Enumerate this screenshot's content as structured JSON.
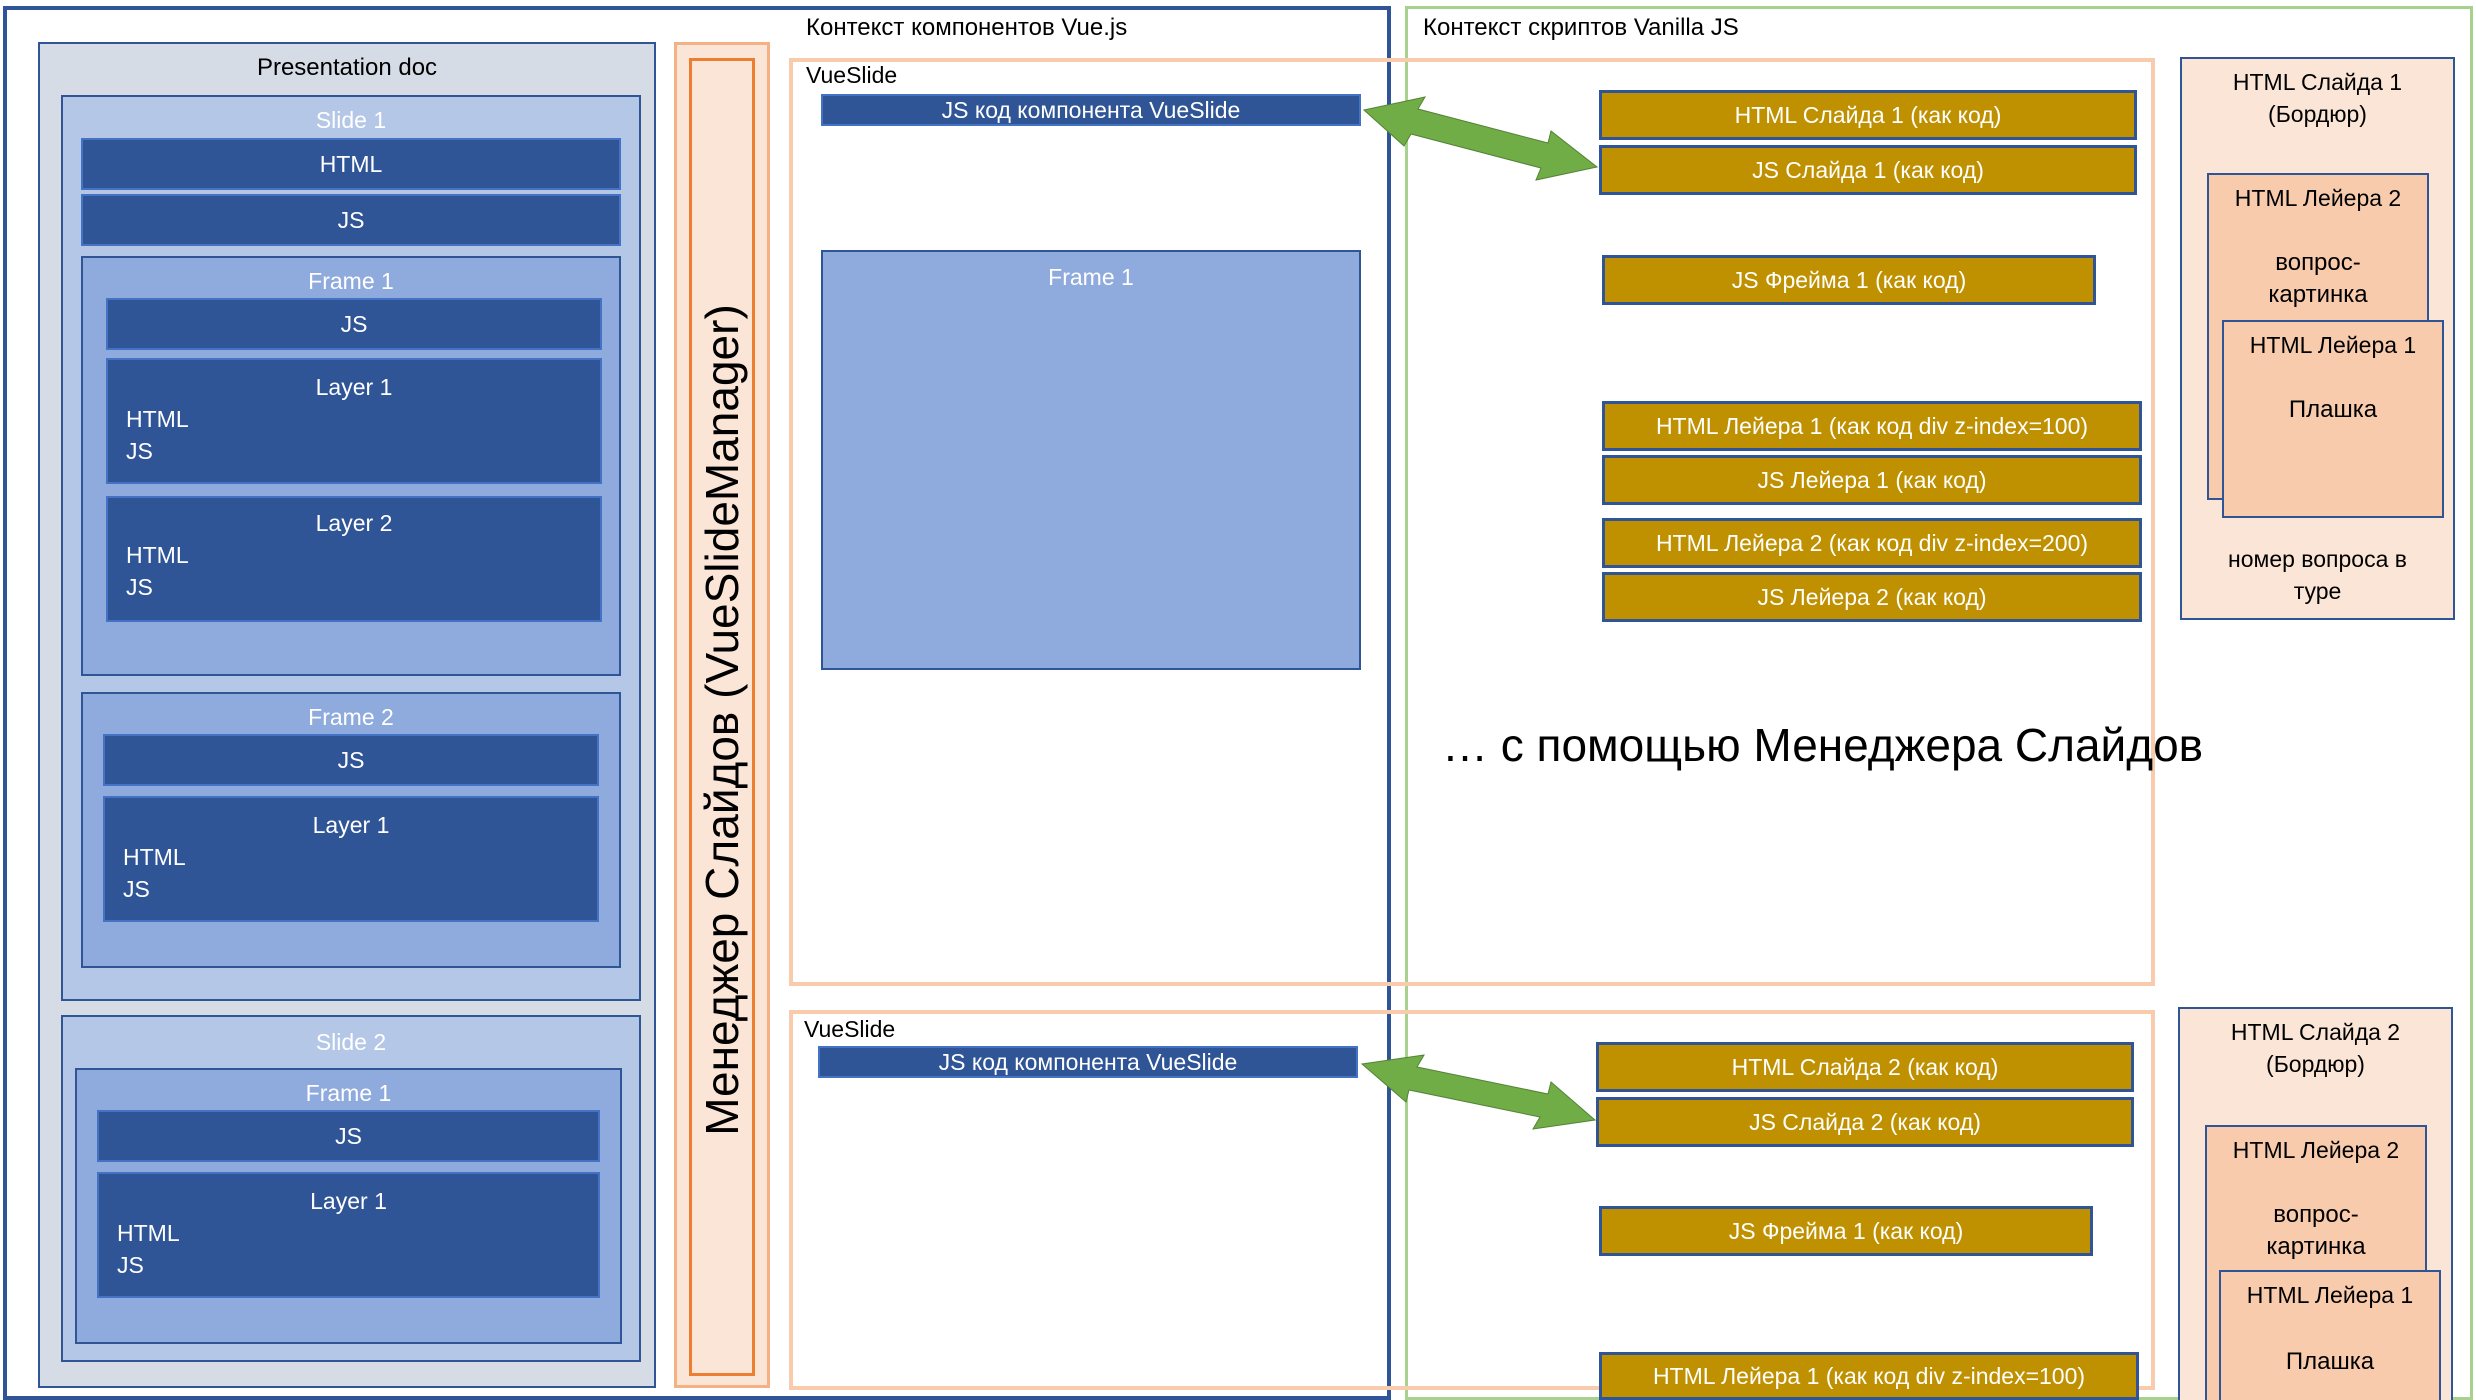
{
  "contexts": {
    "vue_label": "Контекст компонентов Vue.js",
    "vanilla_label": "Контекст скриптов Vanilla JS"
  },
  "presentation": {
    "title": "Presentation doc",
    "slide1": {
      "title": "Slide 1",
      "html": "HTML",
      "js": "JS",
      "frame1": {
        "title": "Frame 1",
        "js": "JS",
        "layer1": {
          "title": "Layer 1",
          "html": "HTML",
          "js": "JS"
        },
        "layer2": {
          "title": "Layer 2",
          "html": "HTML",
          "js": "JS"
        }
      },
      "frame2": {
        "title": "Frame 2",
        "js": "JS",
        "layer1": {
          "title": "Layer 1",
          "html": "HTML",
          "js": "JS"
        }
      }
    },
    "slide2": {
      "title": "Slide 2",
      "frame1": {
        "title": "Frame 1",
        "js": "JS",
        "layer1": {
          "title": "Layer 1",
          "html": "HTML",
          "js": "JS"
        }
      }
    }
  },
  "manager": {
    "label": "Менеджер Слайдов (VueSlideManager)"
  },
  "vueslide1": {
    "label": "VueSlide",
    "js_bar": "JS код компонента VueSlide",
    "frame": "Frame 1"
  },
  "vueslide2": {
    "label": "VueSlide",
    "js_bar": "JS код компонента VueSlide"
  },
  "vanilla1": {
    "html_slide": "HTML Слайда 1  (как код)",
    "js_slide": "JS Слайда 1 (как код)",
    "js_frame": "JS Фрейма 1 (как код)",
    "html_layer1": "HTML Лейера 1  (как код div z-index=100)",
    "js_layer1": "JS Лейера 1 (как код)",
    "html_layer2": "HTML Лейера 2  (как код div z-index=200)",
    "js_layer2": "JS Лейера 2 (как код)"
  },
  "vanilla2": {
    "html_slide": "HTML Слайда 2 (как код)",
    "js_slide": "JS Слайда 2 (как код)",
    "js_frame": "JS Фрейма 1 (как код)",
    "html_layer1": "HTML Лейера 1  (как код div z-index=100)"
  },
  "caption": "… с помощью Менеджера Слайдов",
  "render1": {
    "title_line1": "HTML Слайда 1",
    "title_line2": "(Бордюр)",
    "layer2_title": "HTML Лейера 2",
    "layer2_text_line1": "вопрос-",
    "layer2_text_line2": "картинка",
    "layer1_title": "HTML Лейера 1",
    "layer1_text": "Плашка",
    "footer_line1": "номер вопроса в",
    "footer_line2": "туре"
  },
  "render2": {
    "title_line1": "HTML Слайда 2",
    "title_line2": "(Бордюр)",
    "layer2_title": "HTML Лейера 2",
    "layer2_text_line1": "вопрос-",
    "layer2_text_line2": "картинка",
    "layer1_title": "HTML Лейера 1",
    "layer1_text": "Плашка"
  },
  "colors": {
    "dark_blue": "#2f5597",
    "light_blue": "#8faadc",
    "lighter_blue": "#b4c7e7",
    "grey_panel": "#d6dce5",
    "gold": "#bf9000",
    "peach_border": "#f4b183",
    "peach_fill": "#fbe5d6",
    "arrow_green": "#70ad47",
    "vanilla_border": "#a9d18e"
  }
}
